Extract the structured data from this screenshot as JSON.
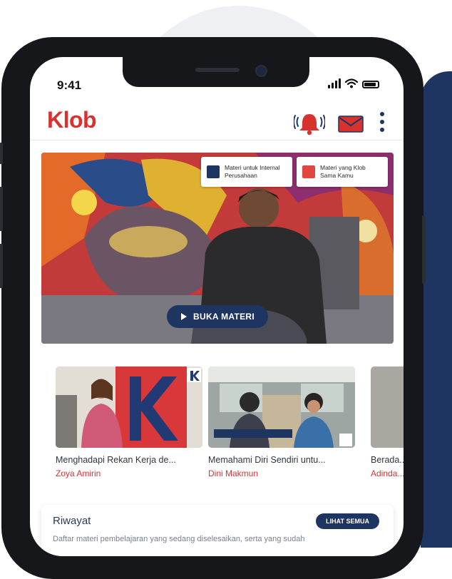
{
  "status_bar": {
    "time": "9:41"
  },
  "app": {
    "logo": "Klob"
  },
  "header_icons": [
    "bell-icon",
    "mail-icon",
    "more-vert-icon"
  ],
  "hero": {
    "chips": [
      {
        "label": "Materi untuk Internal Perusahaan",
        "icon": "building-icon",
        "icon_color": "#1f3561"
      },
      {
        "label": "Materi yang Klob Sama Kamu",
        "icon": "klob-icon",
        "icon_color": "#e0483f"
      }
    ],
    "button_label": "BUKA MATERI"
  },
  "cards": [
    {
      "title": "Menghadapi Rekan Kerja de...",
      "author": "Zoya Amirin"
    },
    {
      "title": "Memahami Diri Sendiri untu...",
      "author": "Dini Makmun"
    },
    {
      "title": "Berada...",
      "author": "Adinda..."
    }
  ],
  "riwayat": {
    "title": "Riwayat",
    "button_label": "LIHAT SEMUA",
    "description": "Daftar materi pembelajaran yang sedang diselesaikan, serta yang sudah"
  },
  "colors": {
    "brand": "#d8322f",
    "navy": "#1f3561"
  }
}
